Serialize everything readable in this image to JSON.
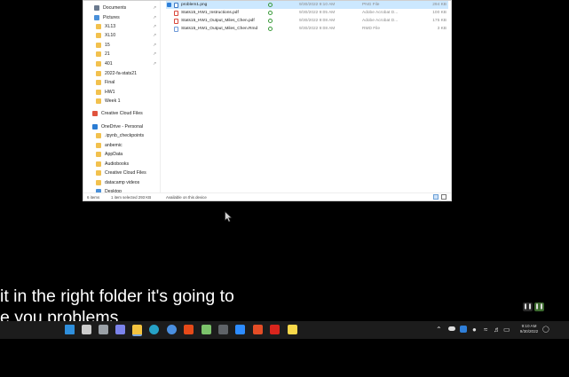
{
  "explorer": {
    "nav_items": [
      {
        "label": "Documents",
        "icon": "documents-icon",
        "color": "#6b7a8f",
        "pinned": true
      },
      {
        "label": "Pictures",
        "icon": "pictures-icon",
        "color": "#4a90d9",
        "pinned": true
      },
      {
        "label": "XL13",
        "icon": "folder-icon",
        "color": "#f2c14e",
        "pinned": true
      },
      {
        "label": "XL10",
        "icon": "folder-icon",
        "color": "#f2c14e",
        "pinned": true
      },
      {
        "label": "15",
        "icon": "folder-icon",
        "color": "#f2c14e",
        "pinned": true
      },
      {
        "label": "21",
        "icon": "folder-icon",
        "color": "#f2c14e",
        "pinned": true
      },
      {
        "label": "401",
        "icon": "folder-icon",
        "color": "#f2c14e",
        "pinned": true
      },
      {
        "label": "2022-fa-stats21",
        "icon": "folder-icon",
        "color": "#f2c14e",
        "pinned": false
      },
      {
        "label": "Final",
        "icon": "folder-icon",
        "color": "#f2c14e",
        "pinned": false
      },
      {
        "label": "HW1",
        "icon": "folder-icon",
        "color": "#f2c14e",
        "pinned": false
      },
      {
        "label": "Week 1",
        "icon": "folder-icon",
        "color": "#f2c14e",
        "pinned": false
      },
      {
        "label": "Creative Cloud Files",
        "icon": "creative-cloud-icon",
        "color": "#e0533d",
        "pinned": false
      },
      {
        "label": "OneDrive - Personal",
        "icon": "onedrive-icon",
        "color": "#2b7cd3",
        "pinned": false
      },
      {
        "label": ".ipynb_checkpoints",
        "icon": "folder-icon",
        "color": "#f2c14e",
        "pinned": false
      },
      {
        "label": "anbemic",
        "icon": "folder-icon",
        "color": "#f2c14e",
        "pinned": false
      },
      {
        "label": "AppData",
        "icon": "folder-icon",
        "color": "#f2c14e",
        "pinned": false
      },
      {
        "label": "Audiobooks",
        "icon": "folder-icon",
        "color": "#f2c14e",
        "pinned": false
      },
      {
        "label": "Creative Cloud Files",
        "icon": "folder-icon",
        "color": "#f2c14e",
        "pinned": false
      },
      {
        "label": "datacamp videos",
        "icon": "folder-icon",
        "color": "#f2c14e",
        "pinned": false
      },
      {
        "label": "Desktop",
        "icon": "folder-icon",
        "color": "#4a90d9",
        "pinned": false
      }
    ],
    "files": [
      {
        "name": "problem1.png",
        "date": "9/30/2022 9:10 AM",
        "type": "PNG File",
        "size": "294 KB",
        "icon": "image-file-icon",
        "icon_color": "#3b78c4",
        "selected": true
      },
      {
        "name": "Stats15_HW1_Instructions.pdf",
        "date": "9/30/2022 9:05 AM",
        "type": "Adobe Acrobat D...",
        "size": "100 KB",
        "icon": "pdf-file-icon",
        "icon_color": "#d9473b",
        "selected": false
      },
      {
        "name": "Stats15_HW1_Output_Miles_Chen.pdf",
        "date": "9/30/2022 9:08 AM",
        "type": "Adobe Acrobat D...",
        "size": "175 KB",
        "icon": "pdf-file-icon",
        "icon_color": "#d9473b",
        "selected": false
      },
      {
        "name": "Stats15_HW1_Output_Miles_Chen.Rmd",
        "date": "9/30/2022 9:08 AM",
        "type": "RMD File",
        "size": "3 KB",
        "icon": "rmd-file-icon",
        "icon_color": "#6f9ad8",
        "selected": false
      }
    ],
    "status": {
      "item_count": "6 items",
      "selection": "1 item selected  293 KB",
      "availability": "Available on this device"
    }
  },
  "caption": {
    "line1": "it in the right folder it's going to",
    "line2": "e you problems"
  },
  "taskbar": {
    "icons": [
      {
        "name": "start-icon",
        "color": "#2f8fdc"
      },
      {
        "name": "search-icon",
        "color": "#cccccc"
      },
      {
        "name": "task-view-icon",
        "color": "#9aa0a6"
      },
      {
        "name": "teams-chat-icon",
        "color": "#7b83eb"
      },
      {
        "name": "file-explorer-icon",
        "color": "#f3c33f"
      },
      {
        "name": "edge-icon",
        "color": "#26a2c7"
      },
      {
        "name": "chrome-icon",
        "color": "#4a8fe0"
      },
      {
        "name": "office-icon",
        "color": "#e64a19"
      },
      {
        "name": "notepad-icon",
        "color": "#7cc36b"
      },
      {
        "name": "calculator-icon",
        "color": "#5f6368"
      },
      {
        "name": "zoom-icon",
        "color": "#2d8cff"
      },
      {
        "name": "html-editor-icon",
        "color": "#e44d26"
      },
      {
        "name": "acrobat-icon",
        "color": "#d9251d"
      },
      {
        "name": "sticky-notes-icon",
        "color": "#f7d84a"
      }
    ],
    "clock": {
      "time": "9:10 AM",
      "date": "9/30/2022"
    }
  },
  "player": {
    "pause_glyph": "❚❚"
  }
}
